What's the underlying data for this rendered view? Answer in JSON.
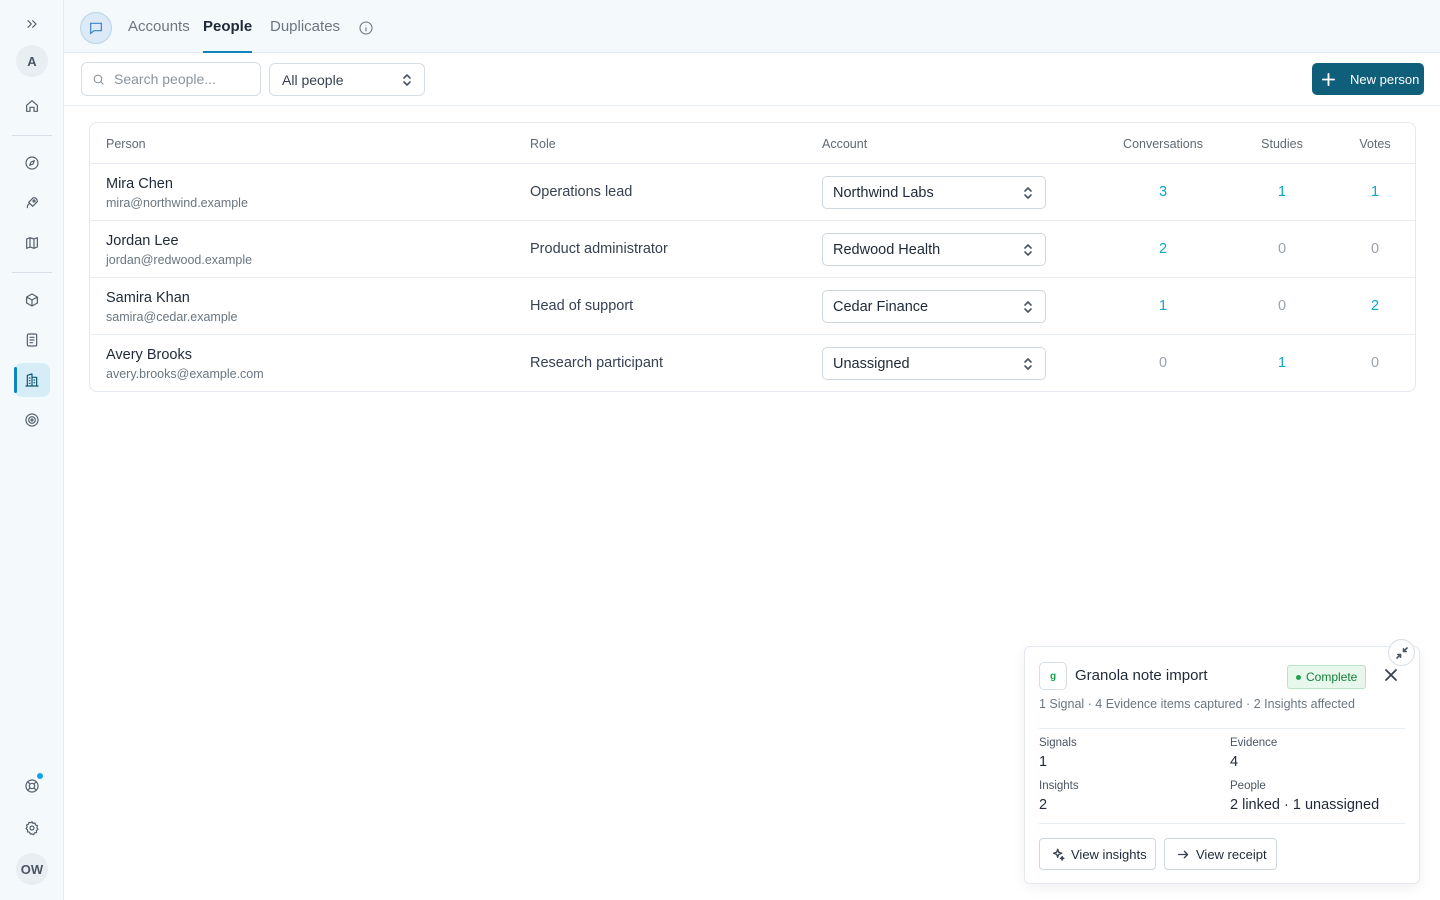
{
  "sidebar": {
    "workspace_initial": "A",
    "user_initials": "OW",
    "icons": [
      "expand-icon",
      "home-icon",
      "compass-icon",
      "rocket-icon",
      "map-icon",
      "box-icon",
      "document-icon",
      "building-icon",
      "target-icon",
      "help-icon",
      "settings-icon"
    ],
    "active_item": "building-icon"
  },
  "tabs": [
    {
      "label": "Accounts",
      "active": false
    },
    {
      "label": "People",
      "active": true
    },
    {
      "label": "Duplicates",
      "active": false
    }
  ],
  "toolbar": {
    "search_placeholder": "Search people...",
    "filter_value": "All people",
    "new_button": "New person"
  },
  "table": {
    "headers": {
      "person": "Person",
      "role": "Role",
      "account": "Account",
      "conversations": "Conversations",
      "studies": "Studies",
      "votes": "Votes"
    },
    "rows": [
      {
        "name": "Mira Chen",
        "email": "mira@northwind.example",
        "role": "Operations lead",
        "account": "Northwind Labs",
        "conversations": "3",
        "studies": "1",
        "votes": "1"
      },
      {
        "name": "Jordan Lee",
        "email": "jordan@redwood.example",
        "role": "Product administrator",
        "account": "Redwood Health",
        "conversations": "2",
        "studies": "0",
        "votes": "0"
      },
      {
        "name": "Samira Khan",
        "email": "samira@cedar.example",
        "role": "Head of support",
        "account": "Cedar Finance",
        "conversations": "1",
        "studies": "0",
        "votes": "2"
      },
      {
        "name": "Avery Brooks",
        "email": "avery.brooks@example.com",
        "role": "Research participant",
        "account": "Unassigned",
        "conversations": "0",
        "studies": "1",
        "votes": "0"
      }
    ]
  },
  "import_panel": {
    "logo_text": "g",
    "title": "Granola note import",
    "status": "Complete",
    "summary": "1 Signal · 4 Evidence items captured · 2 Insights affected",
    "stats": {
      "signals_label": "Signals",
      "signals_value": "1",
      "evidence_label": "Evidence",
      "evidence_value": "4",
      "insights_label": "Insights",
      "insights_value": "2",
      "people_label": "People",
      "people_value": "2 linked · 1 unassigned"
    },
    "view_insights": "View insights",
    "view_receipt": "View receipt"
  },
  "colors": {
    "accent": "#0e87b8",
    "primary_button": "#0f5e7a",
    "link_number": "#0ea5c6",
    "success": "#16803c"
  }
}
